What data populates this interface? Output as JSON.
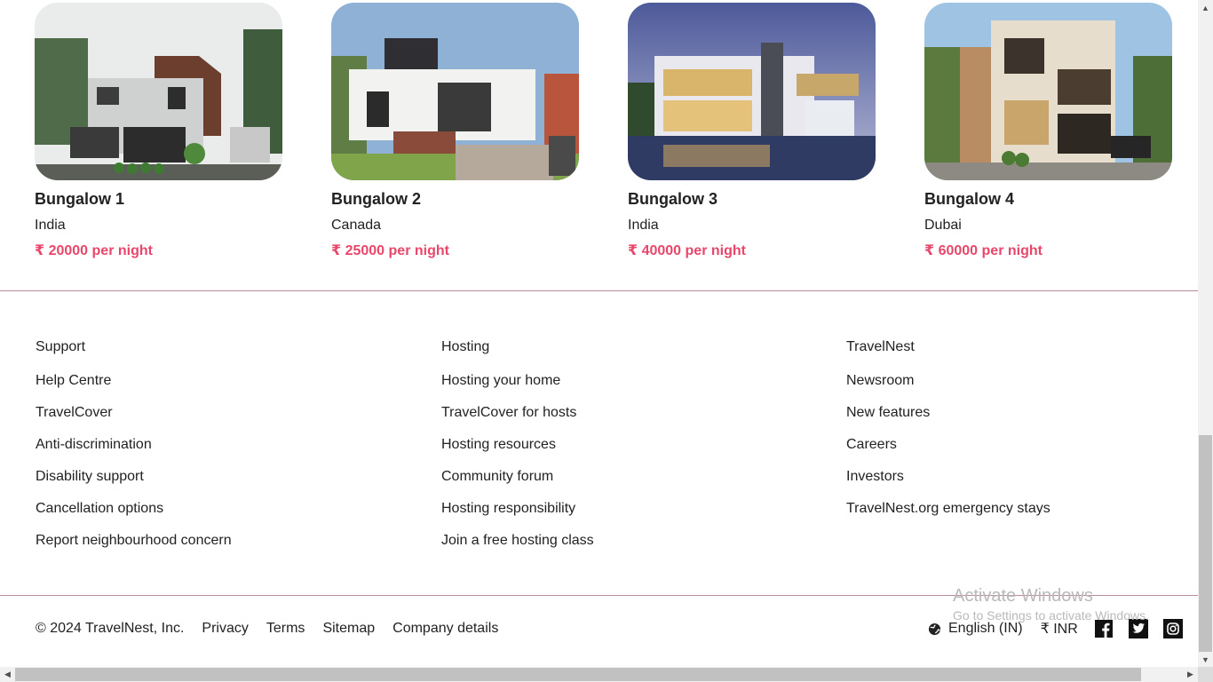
{
  "listings": [
    {
      "title": "Bungalow 1",
      "location": "India",
      "price": "₹ 20000 per night"
    },
    {
      "title": "Bungalow 2",
      "location": "Canada",
      "price": "₹ 25000 per night"
    },
    {
      "title": "Bungalow 3",
      "location": "India",
      "price": "₹ 40000 per night"
    },
    {
      "title": "Bungalow 4",
      "location": "Dubai",
      "price": "₹ 60000 per night"
    }
  ],
  "footer": {
    "support": [
      "Support",
      "Help Centre",
      "TravelCover",
      "Anti-discrimination",
      "Disability support",
      "Cancellation options",
      "Report neighbourhood concern"
    ],
    "hosting": [
      "Hosting",
      "Hosting your home",
      "TravelCover for hosts",
      "Hosting resources",
      "Community forum",
      "Hosting responsibility",
      "Join a free hosting class"
    ],
    "travelnest": [
      "TravelNest",
      "Newsroom",
      "New features",
      "Careers",
      "Investors",
      "TravelNest.org emergency stays"
    ]
  },
  "bottom": {
    "copyright": "© 2024 TravelNest, Inc.",
    "privacy": "Privacy",
    "terms": "Terms",
    "sitemap": "Sitemap",
    "company": "Company details",
    "language": "English (IN)",
    "currency": "₹ INR"
  },
  "icons": {
    "language": "globe-icon",
    "facebook": "facebook-icon",
    "twitter": "twitter-icon",
    "instagram": "instagram-icon"
  },
  "colors": {
    "price": "#e8476b",
    "divider": "#b98f97",
    "text": "#222222"
  },
  "watermark": {
    "line1": "Activate Windows",
    "line2": "Go to Settings to activate Windows."
  }
}
